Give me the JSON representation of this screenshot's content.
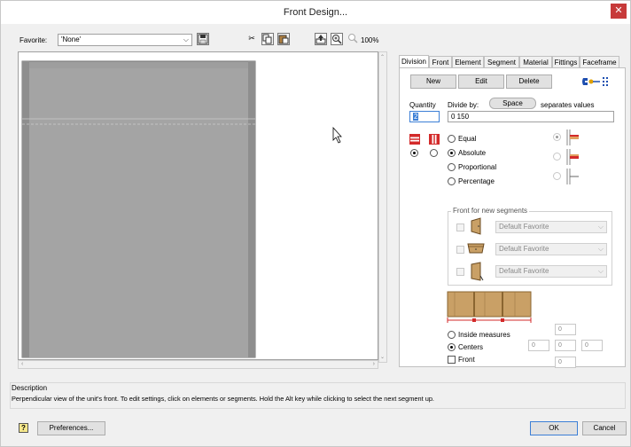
{
  "window": {
    "title": "Front Design...",
    "close_glyph": "✕"
  },
  "toolbar": {
    "favorite_label": "Favorite:",
    "favorite_value": "'None'",
    "zoom_level": "100%"
  },
  "tabs": [
    {
      "label": "Division",
      "active": true
    },
    {
      "label": "Front"
    },
    {
      "label": "Element"
    },
    {
      "label": "Segment"
    },
    {
      "label": "Material"
    },
    {
      "label": "Fittings"
    },
    {
      "label": "Faceframe"
    }
  ],
  "division": {
    "new_label": "New",
    "edit_label": "Edit",
    "delete_label": "Delete",
    "quantity_label": "Quantity",
    "quantity_value": "2",
    "divide_by_label": "Divide by:",
    "space_label": "Space",
    "separates_label": "separates values",
    "divide_value": "0 150",
    "modes": [
      "Equal",
      "Absolute",
      "Proportional",
      "Percentage"
    ],
    "selected_mode": "Absolute"
  },
  "front_group": {
    "title": "Front for new segments",
    "favorites": [
      "Default Favorite",
      "Default Favorite",
      "Default Favorite"
    ]
  },
  "measures": {
    "inside_label": "Inside measures",
    "centers_label": "Centers",
    "front_label": "Front",
    "selected": "Centers",
    "values": [
      "0",
      "0",
      "0",
      "0",
      "0",
      "0"
    ]
  },
  "description": {
    "title": "Description",
    "text": "Perpendicular view of the unit's front. To edit settings, click on elements or segments. Hold the Alt key while clicking to select the next segment up."
  },
  "footer": {
    "help_glyph": "?",
    "preferences_label": "Preferences...",
    "ok_label": "OK",
    "cancel_label": "Cancel"
  },
  "colors": {
    "close_red": "#c73a3a",
    "panel_grey": "#9e9e9e",
    "wood": "#c9a066",
    "accent_red": "#d32a2a"
  }
}
